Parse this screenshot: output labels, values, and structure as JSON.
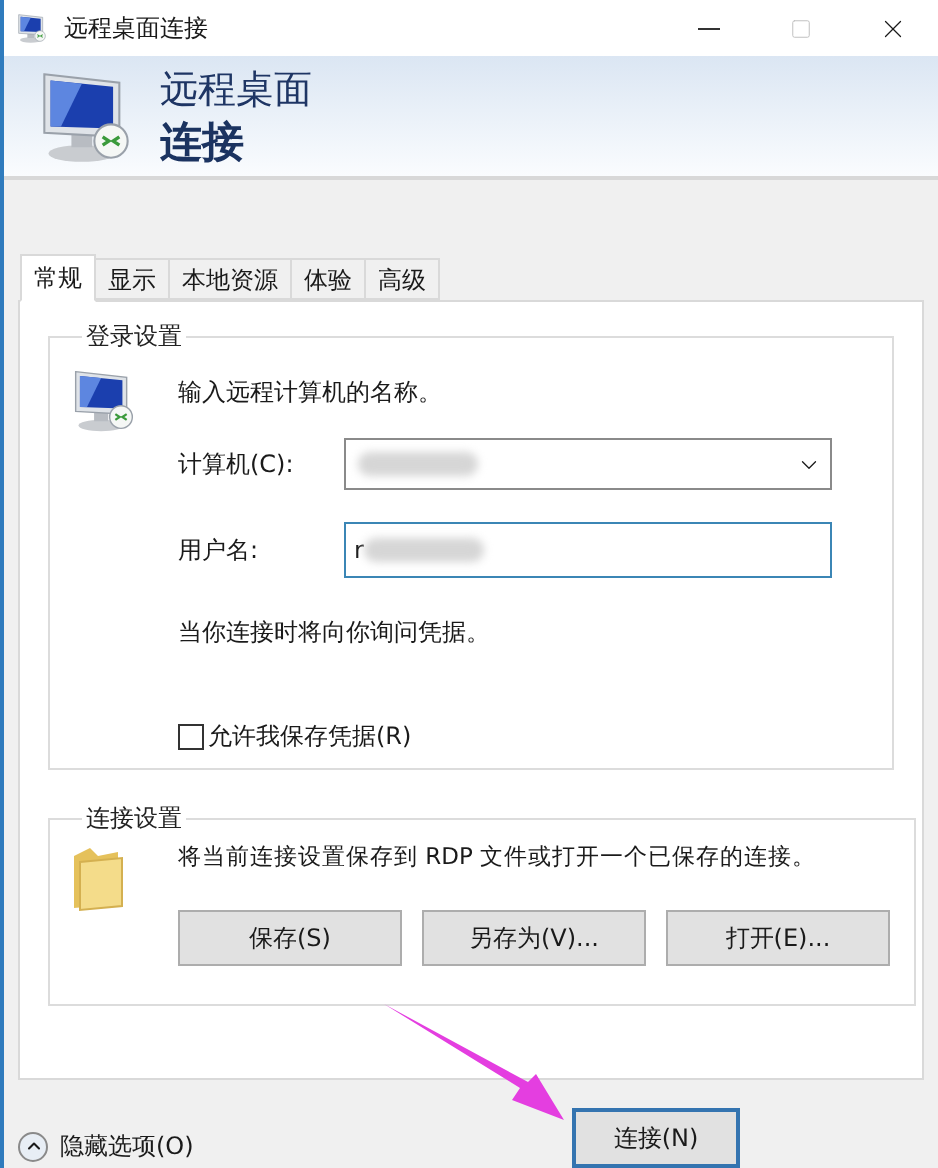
{
  "window": {
    "title": "远程桌面连接"
  },
  "header": {
    "line1": "远程桌面",
    "line2": "连接"
  },
  "tabs": [
    {
      "label": "常规",
      "selected": true
    },
    {
      "label": "显示",
      "selected": false
    },
    {
      "label": "本地资源",
      "selected": false
    },
    {
      "label": "体验",
      "selected": false
    },
    {
      "label": "高级",
      "selected": false
    }
  ],
  "login_group": {
    "title": "登录设置",
    "prompt": "输入远程计算机的名称。",
    "computer_label": "计算机(C):",
    "username_label": "用户名:",
    "username_value": "r",
    "note": "当你连接时将向你询问凭据。",
    "save_credentials": {
      "label": "允许我保存凭据(R)",
      "checked": false
    }
  },
  "connection_group": {
    "title": "连接设置",
    "description": "将当前连接设置保存到 RDP 文件或打开一个已保存的连接。",
    "buttons": [
      "保存(S)",
      "另存为(V)...",
      "打开(E)..."
    ]
  },
  "footer": {
    "toggle_label": "隐藏选项(O)",
    "connect_button": "连接(N)"
  }
}
